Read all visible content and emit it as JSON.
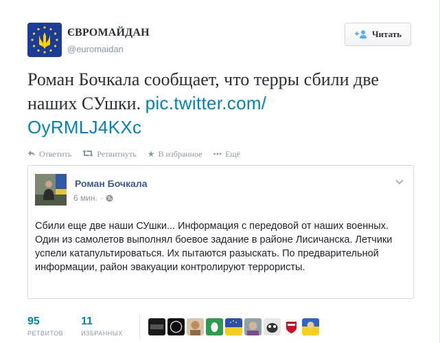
{
  "account": {
    "display_name": "ЄВРОМАЙДАН",
    "screen_name": "@euromaidan",
    "avatar_icon": "ukraine-trident-eu-stars-icon",
    "follow_label": "Читать"
  },
  "tweet": {
    "text": "Роман Бочкала сообщает, что терры сбили две наших СУшки.",
    "link_line1": "pic.twitter.com/",
    "link_line2": "OyRMLJ4KXc"
  },
  "actions": [
    {
      "icon": "reply-icon",
      "label": "Ответить"
    },
    {
      "icon": "retweet-icon",
      "label": "Ретвитнуть"
    },
    {
      "icon": "star-icon",
      "label": "В избранное"
    },
    {
      "icon": "more-icon",
      "label": "Ещё"
    }
  ],
  "card": {
    "author": "Роман Бочкала",
    "time": "6 мин.",
    "separator": "·",
    "body": "Сбили еще две наши СУшки... Информация с передовой от наших военных. Один из самолетов выполнял боевое задание в районе Лисичанска. Летчики успели катапультироваться. Их пытаются разыскать. По предварительной информации, район эвакуации контролируют террористы."
  },
  "stats": {
    "retweets_count": "95",
    "retweets_label": "РЕТВИТОВ",
    "favorites_count": "11",
    "favorites_label": "ИЗБРАННЫХ"
  },
  "colors": {
    "link": "#0084b4",
    "facebook_name": "#3b5998",
    "muted": "#8899a6"
  }
}
